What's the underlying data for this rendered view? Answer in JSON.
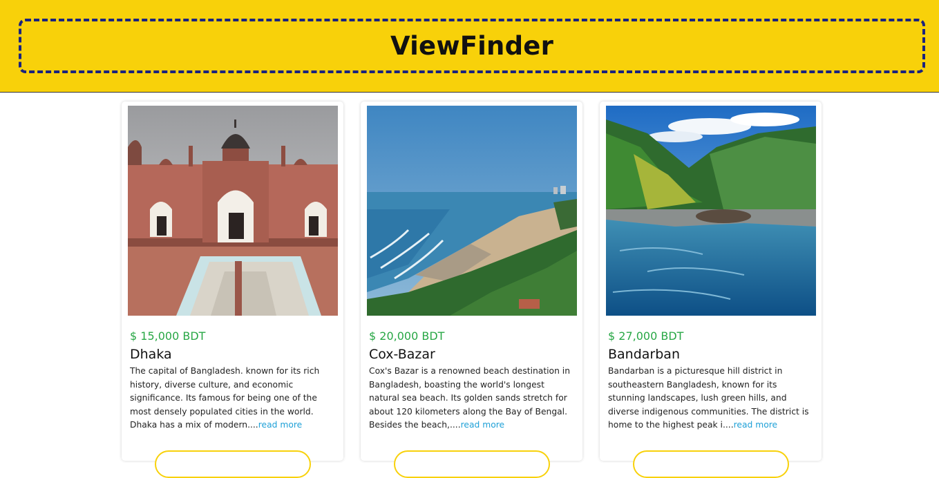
{
  "header": {
    "title": "ViewFinder"
  },
  "cards": [
    {
      "price": "$ 15,000 BDT",
      "name": "Dhaka",
      "description": "The capital of Bangladesh. known for its rich history, diverse culture, and economic significance. Its famous for being one of the most densely populated cities in the world. Dhaka has a mix of modern....",
      "read_more": "read more",
      "image_alt": "dhaka-fort-photo"
    },
    {
      "price": "$ 20,000 BDT",
      "name": "Cox-Bazar",
      "description": "Cox's Bazar is a renowned beach destination in Bangladesh, boasting the world's longest natural sea beach. Its golden sands stretch for about 120 kilometers along the Bay of Bengal. Besides the beach,....",
      "read_more": "read more",
      "image_alt": "cox-bazar-beach-photo"
    },
    {
      "price": "$ 27,000 BDT",
      "name": "Bandarban",
      "description": "Bandarban is a picturesque hill district in southeastern Bangladesh, known for its stunning landscapes, lush green hills, and diverse indigenous communities. The district is home to the highest peak i....",
      "read_more": "read more",
      "image_alt": "bandarban-river-photo"
    }
  ],
  "colors": {
    "header_bg": "#f8d10a",
    "frame": "#1a237e",
    "price": "#28a745",
    "link": "#1ea0d7"
  }
}
